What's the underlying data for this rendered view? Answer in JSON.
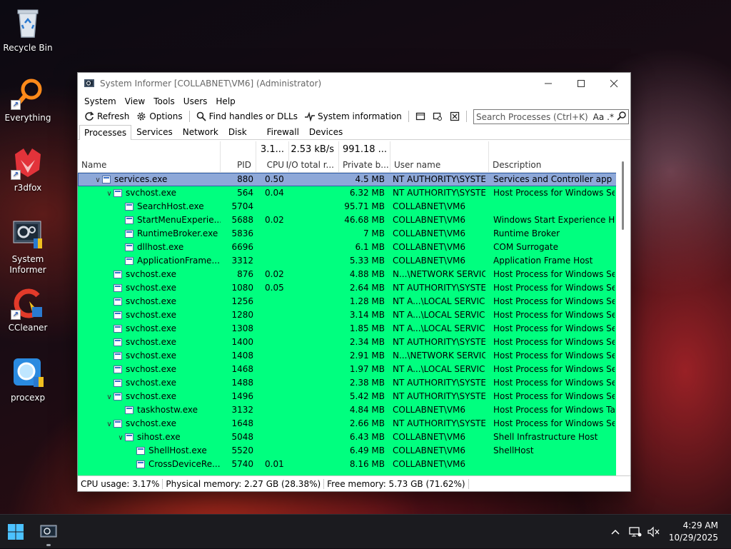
{
  "desktop": {
    "icons": [
      {
        "label": "Recycle Bin"
      },
      {
        "label": "Everything"
      },
      {
        "label": "r3dfox"
      },
      {
        "label": "System Informer"
      },
      {
        "label": "CCleaner"
      },
      {
        "label": "procexp"
      }
    ]
  },
  "window": {
    "title": "System Informer [COLLABNET\\VM6] (Administrator)",
    "menu": [
      "System",
      "View",
      "Tools",
      "Users",
      "Help"
    ],
    "toolbar": {
      "refresh": "Refresh",
      "options": "Options",
      "find_handles": "Find handles or DLLs",
      "system_information": "System information"
    },
    "search": {
      "placeholder": "Search Processes (Ctrl+K)",
      "case_label": "Aa",
      "regex_label": ".*"
    },
    "tabs": [
      "Processes",
      "Services",
      "Network",
      "Disk",
      "Firewall",
      "Devices"
    ],
    "active_tab": "Processes",
    "columns": {
      "name": "Name",
      "pid": "PID",
      "cpu": "CPU",
      "io": "I/O total r...",
      "private": "Private b...",
      "user": "User name",
      "description": "Description"
    },
    "summary": {
      "cpu": "3.1...",
      "io": "2.53 kB/s",
      "private": "991.18 ..."
    },
    "processes": [
      {
        "exp": "v",
        "name": "services.exe",
        "pid": "880",
        "cpu": "0.50",
        "io": "",
        "priv": "4.5 MB",
        "user": "NT AUTHORITY\\SYSTEM",
        "desc": "Services and Controller app"
      },
      {
        "exp": "v",
        "name": "svchost.exe",
        "pid": "564",
        "cpu": "0.04",
        "io": "",
        "priv": "6.32 MB",
        "user": "NT AUTHORITY\\SYSTEM",
        "desc": "Host Process for Windows Ser..."
      },
      {
        "exp": "",
        "name": "SearchHost.exe",
        "pid": "5704",
        "cpu": "",
        "io": "",
        "priv": "95.71 MB",
        "user": "COLLABNET\\VM6",
        "desc": ""
      },
      {
        "exp": "",
        "name": "StartMenuExperie...",
        "pid": "5688",
        "cpu": "0.02",
        "io": "",
        "priv": "46.68 MB",
        "user": "COLLABNET\\VM6",
        "desc": "Windows Start Experience Host"
      },
      {
        "exp": "",
        "name": "RuntimeBroker.exe",
        "pid": "5836",
        "cpu": "",
        "io": "",
        "priv": "7 MB",
        "user": "COLLABNET\\VM6",
        "desc": "Runtime Broker"
      },
      {
        "exp": "",
        "name": "dllhost.exe",
        "pid": "6696",
        "cpu": "",
        "io": "",
        "priv": "6.1 MB",
        "user": "COLLABNET\\VM6",
        "desc": "COM Surrogate"
      },
      {
        "exp": "",
        "name": "ApplicationFrame...",
        "pid": "3312",
        "cpu": "",
        "io": "",
        "priv": "5.33 MB",
        "user": "COLLABNET\\VM6",
        "desc": "Application Frame Host"
      },
      {
        "exp": "",
        "name": "svchost.exe",
        "pid": "876",
        "cpu": "0.02",
        "io": "",
        "priv": "4.88 MB",
        "user": "N...\\NETWORK SERVICE",
        "desc": "Host Process for Windows Ser..."
      },
      {
        "exp": "",
        "name": "svchost.exe",
        "pid": "1080",
        "cpu": "0.05",
        "io": "",
        "priv": "2.64 MB",
        "user": "NT AUTHORITY\\SYSTEM",
        "desc": "Host Process for Windows Ser..."
      },
      {
        "exp": "",
        "name": "svchost.exe",
        "pid": "1256",
        "cpu": "",
        "io": "",
        "priv": "1.28 MB",
        "user": "NT A...\\LOCAL SERVICE",
        "desc": "Host Process for Windows Ser..."
      },
      {
        "exp": "",
        "name": "svchost.exe",
        "pid": "1280",
        "cpu": "",
        "io": "",
        "priv": "3.14 MB",
        "user": "NT A...\\LOCAL SERVICE",
        "desc": "Host Process for Windows Ser..."
      },
      {
        "exp": "",
        "name": "svchost.exe",
        "pid": "1308",
        "cpu": "",
        "io": "",
        "priv": "1.85 MB",
        "user": "NT A...\\LOCAL SERVICE",
        "desc": "Host Process for Windows Ser..."
      },
      {
        "exp": "",
        "name": "svchost.exe",
        "pid": "1400",
        "cpu": "",
        "io": "",
        "priv": "2.34 MB",
        "user": "NT AUTHORITY\\SYSTEM",
        "desc": "Host Process for Windows Ser..."
      },
      {
        "exp": "",
        "name": "svchost.exe",
        "pid": "1408",
        "cpu": "",
        "io": "",
        "priv": "2.91 MB",
        "user": "N...\\NETWORK SERVICE",
        "desc": "Host Process for Windows Ser..."
      },
      {
        "exp": "",
        "name": "svchost.exe",
        "pid": "1468",
        "cpu": "",
        "io": "",
        "priv": "1.97 MB",
        "user": "NT A...\\LOCAL SERVICE",
        "desc": "Host Process for Windows Ser..."
      },
      {
        "exp": "",
        "name": "svchost.exe",
        "pid": "1488",
        "cpu": "",
        "io": "",
        "priv": "2.38 MB",
        "user": "NT AUTHORITY\\SYSTEM",
        "desc": "Host Process for Windows Ser..."
      },
      {
        "exp": "v",
        "name": "svchost.exe",
        "pid": "1496",
        "cpu": "",
        "io": "",
        "priv": "5.42 MB",
        "user": "NT AUTHORITY\\SYSTEM",
        "desc": "Host Process for Windows Ser..."
      },
      {
        "exp": "",
        "name": "taskhostw.exe",
        "pid": "3132",
        "cpu": "",
        "io": "",
        "priv": "4.84 MB",
        "user": "COLLABNET\\VM6",
        "desc": "Host Process for Windows Tas..."
      },
      {
        "exp": "v",
        "name": "svchost.exe",
        "pid": "1648",
        "cpu": "",
        "io": "",
        "priv": "2.66 MB",
        "user": "NT AUTHORITY\\SYSTEM",
        "desc": "Host Process for Windows Ser..."
      },
      {
        "exp": "v",
        "name": "sihost.exe",
        "pid": "5048",
        "cpu": "",
        "io": "",
        "priv": "6.43 MB",
        "user": "COLLABNET\\VM6",
        "desc": "Shell Infrastructure Host"
      },
      {
        "exp": "",
        "name": "ShellHost.exe",
        "pid": "5520",
        "cpu": "",
        "io": "",
        "priv": "6.49 MB",
        "user": "COLLABNET\\VM6",
        "desc": "ShellHost"
      },
      {
        "exp": "",
        "name": "CrossDeviceRe...",
        "pid": "5740",
        "cpu": "0.01",
        "io": "",
        "priv": "8.16 MB",
        "user": "COLLABNET\\VM6",
        "desc": ""
      }
    ],
    "status": {
      "cpu_usage": "CPU usage: 3.17%",
      "physical_memory": "Physical memory: 2.27 GB (28.38%)",
      "free_memory": "Free memory: 5.73 GB (71.62%)"
    },
    "colors": {
      "service_row": "#00ff7f",
      "selected_row": "#8ea8d8"
    }
  },
  "taskbar": {
    "time": "4:29 AM",
    "date": "10/29/2025"
  }
}
